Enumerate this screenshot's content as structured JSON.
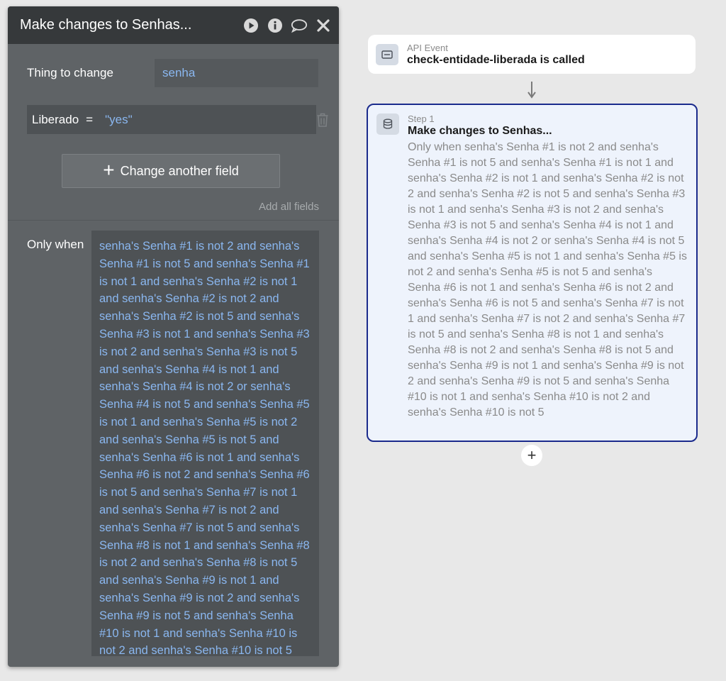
{
  "panel": {
    "title": "Make changes to Senhas...",
    "thing_label": "Thing to change",
    "thing_value": "senha",
    "field": {
      "name": "Liberado",
      "operator": "=",
      "value": "\"yes\""
    },
    "add_field_label": "Change another field",
    "add_all_label": "Add all fields",
    "only_when_label": "Only when",
    "only_when_expression": "senha's Senha #1 is not 2 and senha's Senha #1 is not 5 and senha's Senha #1 is not 1 and senha's Senha #2 is not 1 and senha's Senha #2 is not 2 and senha's Senha #2 is not 5 and senha's Senha #3 is not 1 and senha's Senha #3 is not 2 and senha's Senha #3 is not 5 and senha's Senha #4 is not 1 and senha's Senha #4 is not 2 or senha's Senha #4 is not 5 and senha's Senha #5 is not 1 and senha's Senha #5 is not 2 and senha's Senha #5 is not 5 and senha's Senha #6 is not 1 and senha's Senha #6 is not 2 and senha's Senha #6 is not 5 and senha's Senha #7 is not 1 and senha's Senha #7 is not 2 and senha's Senha #7 is not 5 and senha's Senha #8 is not 1 and senha's Senha #8 is not 2 and senha's Senha #8 is not 5 and senha's Senha #9 is not 1 and senha's Senha #9 is not 2 and senha's Senha #9 is not 5 and senha's Senha #10 is not 1 and senha's Senha #10 is not 2 and senha's Senha #10 is not 5",
    "header_icons": [
      "play-icon",
      "info-icon",
      "comment-icon",
      "close-icon"
    ]
  },
  "workflow": {
    "event": {
      "kind": "API Event",
      "name": "check-entidade-liberada is called",
      "icon": "api-icon"
    },
    "step": {
      "kind": "Step 1",
      "name": "Make changes to Senhas...",
      "icon": "database-icon",
      "description": "Only when senha's Senha #1 is not 2 and senha's Senha #1 is not 5 and senha's Senha #1 is not 1 and senha's Senha #2 is not 1 and senha's Senha #2 is not 2 and senha's Senha #2 is not 5 and senha's Senha #3 is not 1 and senha's Senha #3 is not 2 and senha's Senha #3 is not 5 and senha's Senha #4 is not 1 and senha's Senha #4 is not 2 or senha's Senha #4 is not 5 and senha's Senha #5 is not 1 and senha's Senha #5 is not 2 and senha's Senha #5 is not 5 and senha's Senha #6 is not 1 and senha's Senha #6 is not 2 and senha's Senha #6 is not 5 and senha's Senha #7 is not 1 and senha's Senha #7 is not 2 and senha's Senha #7 is not 5 and senha's Senha #8 is not 1 and senha's Senha #8 is not 2 and senha's Senha #8 is not 5 and senha's Senha #9 is not 1 and senha's Senha #9 is not 2 and senha's Senha #9 is not 5 and senha's Senha #10 is not 1 and senha's Senha #10 is not 2 and senha's Senha #10 is not 5"
    },
    "add_step_label": "+"
  },
  "colors": {
    "panel_bg": "#5f6366",
    "header_bg": "#36393b",
    "link_blue": "#8ab7f0",
    "step_border": "#1a2a8c",
    "canvas_bg": "#e8e8e8"
  }
}
